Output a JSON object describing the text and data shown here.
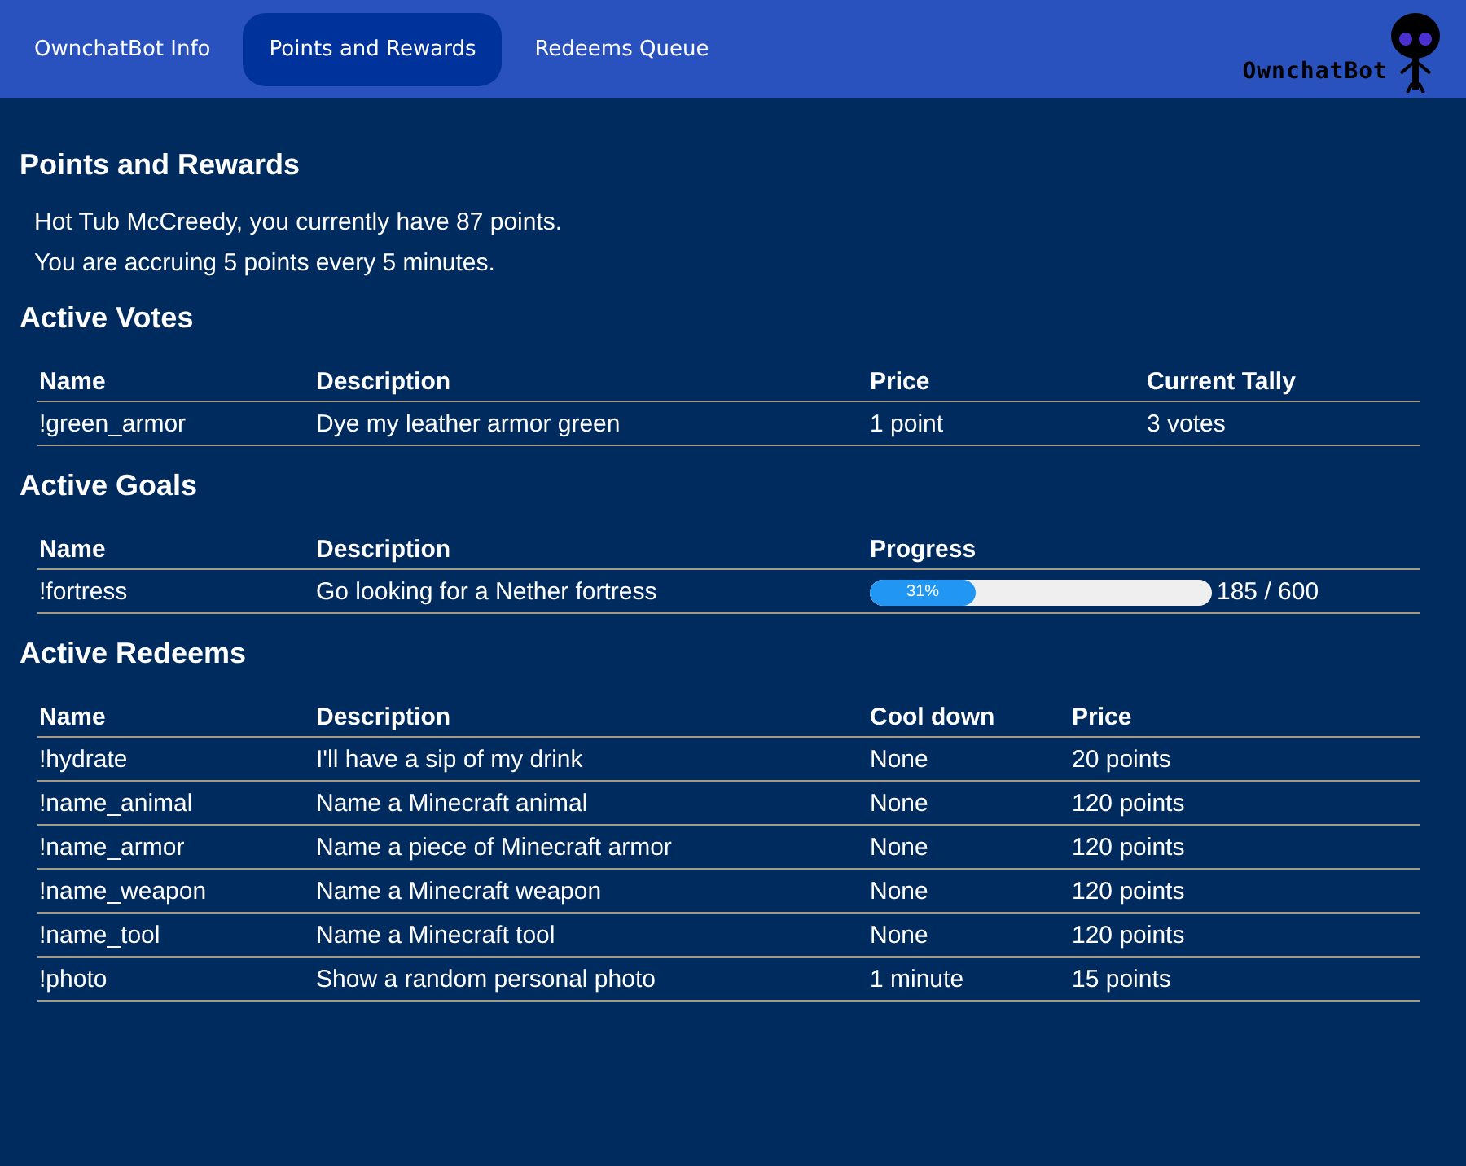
{
  "nav": {
    "tabs": [
      {
        "label": "OwnchatBot Info",
        "selected": false
      },
      {
        "label": "Points and Rewards",
        "selected": true
      },
      {
        "label": "Redeems Queue",
        "selected": false
      }
    ],
    "logo_text": "OwnchatBot"
  },
  "page_title": "Points and Rewards",
  "summary": [
    "Hot Tub McCreedy, you currently have 87 points.",
    "You are accruing 5 points every 5 minutes."
  ],
  "sections": [
    {
      "title": "Active Votes",
      "kind": "votes",
      "columns": [
        "Name",
        "Description",
        "Price",
        "Current Tally"
      ],
      "rows": [
        {
          "cells": [
            "!green_armor",
            "Dye my leather armor green",
            "1 point",
            "3 votes"
          ]
        }
      ]
    },
    {
      "title": "Active Goals",
      "kind": "goals",
      "columns": [
        "Name",
        "Description",
        "Progress"
      ],
      "rows": [
        {
          "cells": [
            "!fortress",
            "Go looking for a Nether fortress"
          ],
          "progress": {
            "level": 0.31,
            "label": "31%",
            "reading": "185 / 600"
          }
        }
      ]
    },
    {
      "title": "Active Redeems",
      "kind": "redeems",
      "columns": [
        "Name",
        "Description",
        "Cool down",
        "Price"
      ],
      "rows": [
        {
          "cells": [
            "!hydrate",
            "I'll have a sip of my drink",
            "None",
            "20 points"
          ]
        },
        {
          "cells": [
            "!name_animal",
            "Name a Minecraft animal",
            "None",
            "120 points"
          ]
        },
        {
          "cells": [
            "!name_armor",
            "Name a piece of Minecraft armor",
            "None",
            "120 points"
          ]
        },
        {
          "cells": [
            "!name_weapon",
            "Name a Minecraft weapon",
            "None",
            "120 points"
          ]
        },
        {
          "cells": [
            "!name_tool",
            "Name a Minecraft tool",
            "None",
            "120 points"
          ]
        },
        {
          "cells": [
            "!photo",
            "Show a random personal photo",
            "1 minute",
            "15 points"
          ]
        }
      ]
    }
  ]
}
